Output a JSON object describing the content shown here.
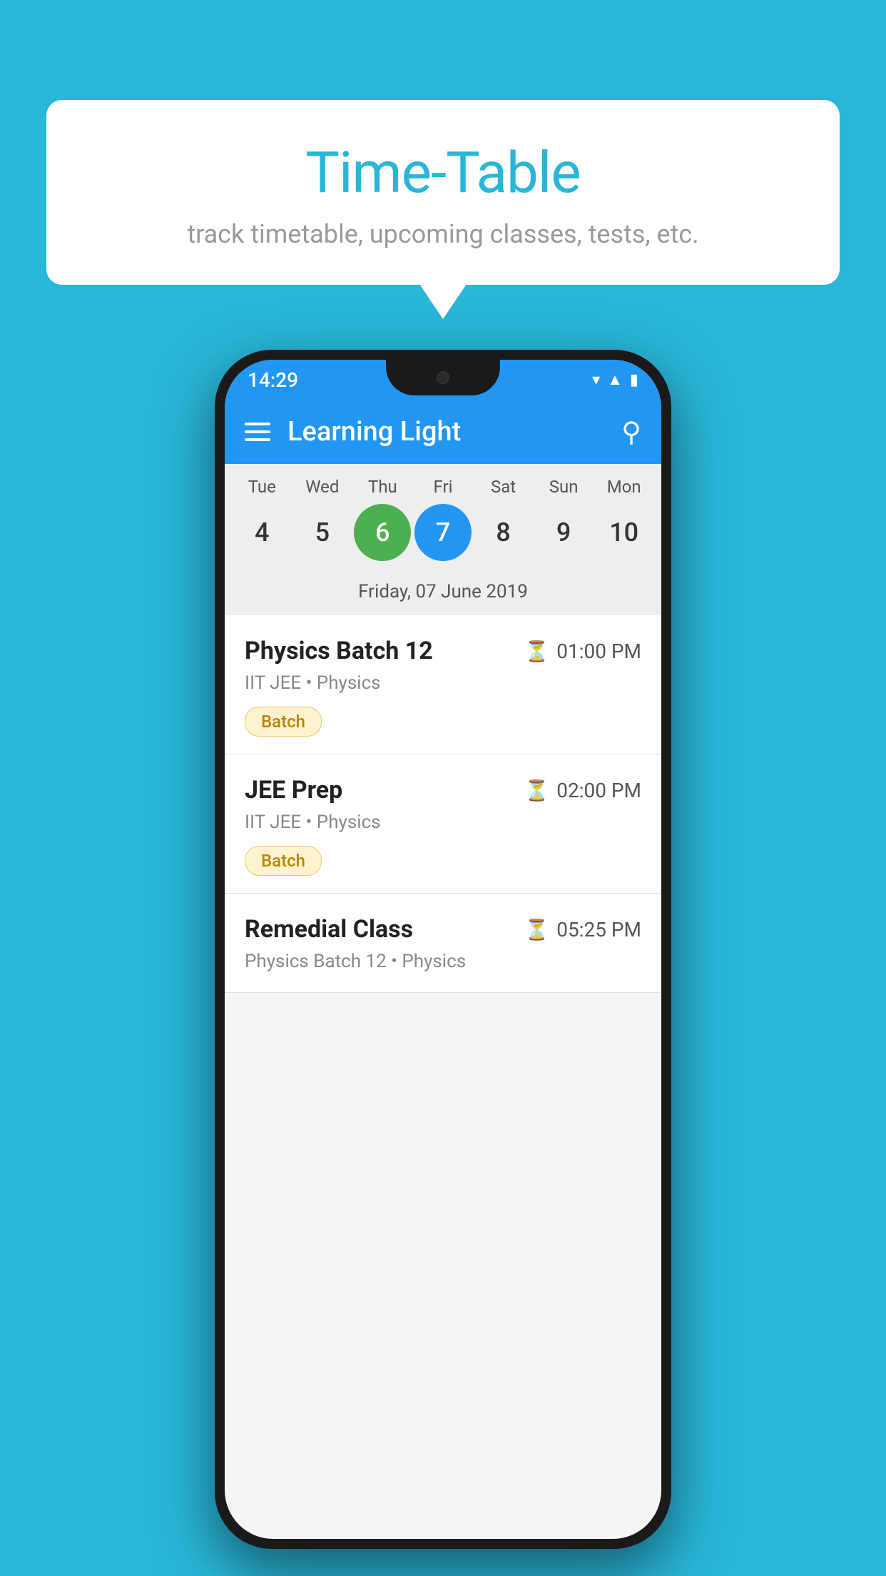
{
  "background_color": "#29b6d8",
  "bubble": {
    "title": "Time-Table",
    "subtitle": "track timetable, upcoming classes, tests, etc."
  },
  "phone": {
    "status_bar": {
      "time": "14:29",
      "icons": [
        "wifi",
        "signal",
        "battery"
      ]
    },
    "app_bar": {
      "title": "Learning Light"
    },
    "calendar": {
      "days": [
        {
          "label": "Tue",
          "number": "4",
          "state": "normal"
        },
        {
          "label": "Wed",
          "number": "5",
          "state": "normal"
        },
        {
          "label": "Thu",
          "number": "6",
          "state": "today"
        },
        {
          "label": "Fri",
          "number": "7",
          "state": "selected"
        },
        {
          "label": "Sat",
          "number": "8",
          "state": "normal"
        },
        {
          "label": "Sun",
          "number": "9",
          "state": "normal"
        },
        {
          "label": "Mon",
          "number": "10",
          "state": "normal"
        }
      ],
      "selected_date": "Friday, 07 June 2019"
    },
    "schedule": [
      {
        "title": "Physics Batch 12",
        "time": "01:00 PM",
        "subtitle": "IIT JEE • Physics",
        "badge": "Batch"
      },
      {
        "title": "JEE Prep",
        "time": "02:00 PM",
        "subtitle": "IIT JEE • Physics",
        "badge": "Batch"
      },
      {
        "title": "Remedial Class",
        "time": "05:25 PM",
        "subtitle": "Physics Batch 12 • Physics",
        "badge": null
      }
    ]
  }
}
